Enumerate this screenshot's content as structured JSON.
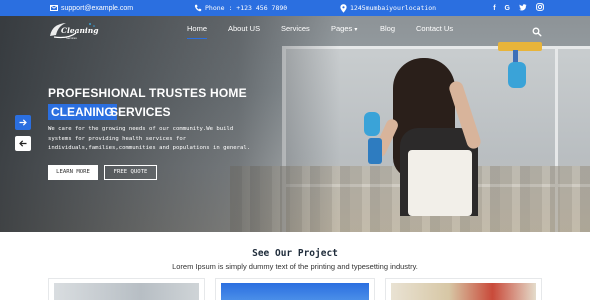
{
  "topbar": {
    "email": "support@example.com",
    "phone": "Phone : +123 456 7890",
    "location": "1245mumbaiyourlocation",
    "socials": [
      "facebook-icon",
      "google-icon",
      "twitter-icon",
      "instagram-icon"
    ]
  },
  "nav": {
    "items": [
      "Home",
      "About US",
      "Services",
      "Pages",
      "Blog",
      "Contact Us"
    ],
    "active": "Home"
  },
  "hero": {
    "headline_line1": "PROFESHIONAL TRUSTES HOME",
    "headline_highlight": "CLEANING",
    "headline_line2_rest": "SERVICES",
    "description_lines": [
      "We care for the growing needs of our community.We build",
      "systems for providing health services for",
      "individuals,families,communities and populations in general."
    ],
    "learn_more": "LEARN MORE",
    "free_quote": "FREE QUOTE"
  },
  "section": {
    "title": "See Our Project",
    "subtitle": "Lorem Ipsum is simply dummy text of the printing and typesetting industry."
  },
  "colors": {
    "accent": "#2b6fe0",
    "topbar": "#2b6fe0",
    "heading": "#1e2b3a"
  }
}
